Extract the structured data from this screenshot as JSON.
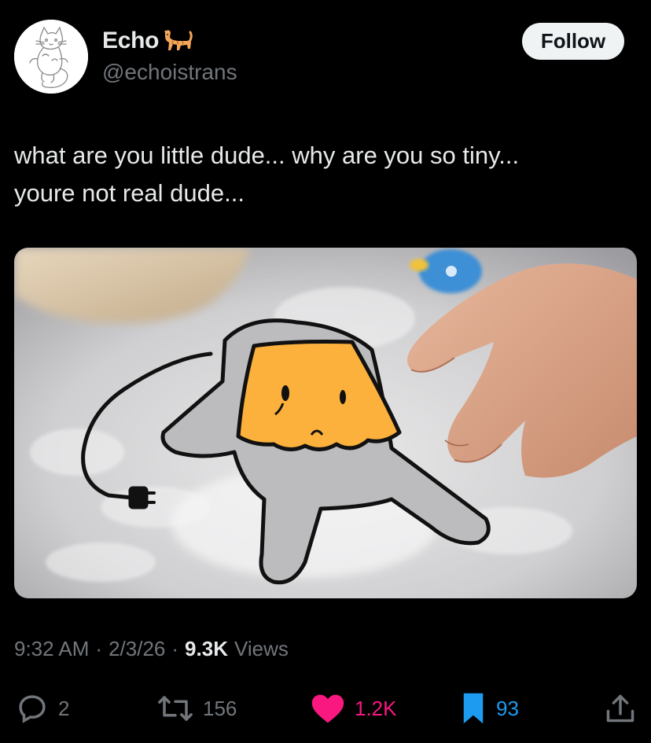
{
  "author": {
    "display_name": "Echo",
    "handle": "@echoistrans",
    "name_emoji": "cat-emoji",
    "avatar": "cat-sketch-avatar"
  },
  "follow_label": "Follow",
  "tweet": {
    "text_line1": "what are you little dude... why are you so tiny...",
    "text_line2": "youre not real dude...",
    "media": "photo-of-hand-poking-drawn-gray-creature-with-orange-face-and-plug-tail-on-fluffy-rug"
  },
  "meta": {
    "time": "9:32 AM",
    "date": "2/3/26",
    "views_count": "9.3K",
    "views_label": "Views"
  },
  "actions": {
    "replies": "2",
    "reposts": "156",
    "likes": "1.2K",
    "bookmarks": "93"
  },
  "colors": {
    "background": "#000000",
    "text": "#e7e9ea",
    "secondary": "#71767b",
    "like": "#f91880",
    "bookmark": "#1d9bf0",
    "follow_bg": "#eff3f4"
  },
  "icons": [
    "reply-icon",
    "repost-icon",
    "like-icon",
    "bookmark-icon",
    "share-icon"
  ]
}
